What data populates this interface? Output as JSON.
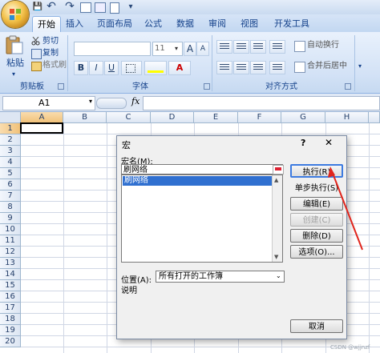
{
  "quick_access": {
    "save": "💾",
    "undo": "↶",
    "redo": "↷",
    "more": "▾"
  },
  "tabs": [
    "开始",
    "插入",
    "页面布局",
    "公式",
    "数据",
    "审阅",
    "视图",
    "开发工具"
  ],
  "ribbon": {
    "paste_label": "粘贴",
    "cut_label": "剪切",
    "copy_label": "复制",
    "format_painter_label": "格式刷",
    "clipboard_group": "剪贴板",
    "font_size": "11",
    "grow_font": "A",
    "shrink_font": "A",
    "bold": "B",
    "italic": "I",
    "underline": "U",
    "font_color": "A",
    "font_group": "字体",
    "wrap_text_label": "自动换行",
    "merge_center_label": "合并后居中",
    "align_group": "对齐方式"
  },
  "formula_bar": {
    "name_box": "A1",
    "fx": "fx",
    "formula": ""
  },
  "grid": {
    "columns": [
      "A",
      "B",
      "C",
      "D",
      "E",
      "F",
      "G",
      "H"
    ],
    "rows": [
      "1",
      "2",
      "3",
      "4",
      "5",
      "6",
      "7",
      "8",
      "9",
      "10",
      "11",
      "12",
      "13",
      "14",
      "15",
      "16",
      "17",
      "18",
      "19",
      "20"
    ]
  },
  "dialog": {
    "title": "宏",
    "help": "?",
    "close": "✕",
    "macro_name_label": "宏名(M):",
    "macro_name_value": "刷网络",
    "macro_list": [
      "刷网络"
    ],
    "location_label": "位置(A):",
    "location_value": "所有打开的工作簿",
    "description_label": "说明",
    "buttons": {
      "run": "执行(R)",
      "step_into": "单步执行(S)",
      "edit": "编辑(E)",
      "create": "创建(C)",
      "delete": "删除(D)",
      "options": "选项(O)...",
      "cancel": "取消"
    }
  },
  "watermark": "CSDN @wjjnzf"
}
